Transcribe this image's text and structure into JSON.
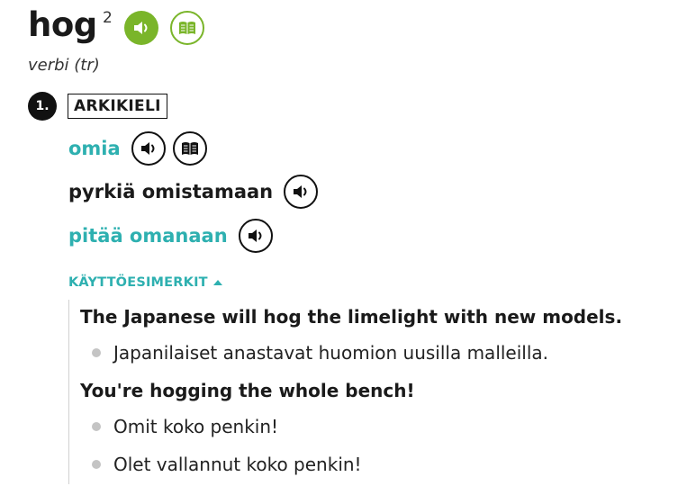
{
  "entry": {
    "headword": "hog",
    "homograph": "2",
    "pos": "verbi (tr)"
  },
  "sense": {
    "number": "1.",
    "register": "ARKIKIELI",
    "translations": [
      {
        "text": "omia",
        "linked": true,
        "icons": [
          "speaker-icon",
          "book-icon"
        ]
      },
      {
        "text": "pyrkiä omistamaan",
        "linked": false,
        "icons": [
          "speaker-icon"
        ]
      },
      {
        "text": "pitää omanaan",
        "linked": true,
        "icons": [
          "speaker-icon"
        ]
      }
    ]
  },
  "examples": {
    "toggle_label": "KÄYTTÖESIMERKIT",
    "items": [
      {
        "source": "The Japanese will hog the limelight with new models.",
        "translations": [
          "Japanilaiset anastavat huomion uusilla malleilla."
        ]
      },
      {
        "source": "You're hogging the whole bench!",
        "translations": [
          "Omit koko penkin!",
          "Olet vallannut koko penkin!"
        ]
      }
    ]
  },
  "colors": {
    "accent_green": "#7ab52a",
    "link_teal": "#2eb0b0",
    "text_dark": "#1a1a1a",
    "bullet_gray": "#c4c4c4"
  }
}
